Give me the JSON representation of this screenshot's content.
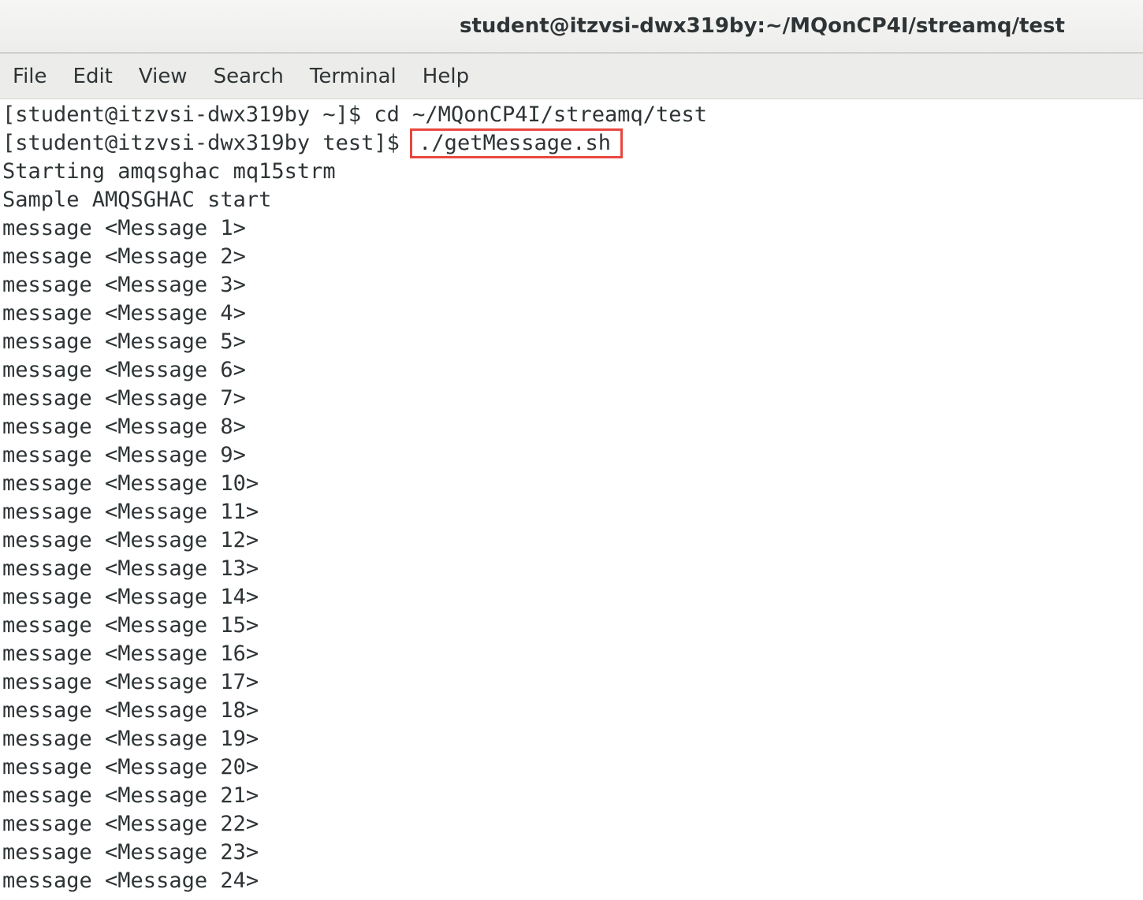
{
  "window": {
    "title": "student@itzvsi-dwx319by:~/MQonCP4I/streamq/test"
  },
  "menubar": {
    "items": [
      "File",
      "Edit",
      "View",
      "Search",
      "Terminal",
      "Help"
    ]
  },
  "terminal": {
    "line1": {
      "prompt": "[student@itzvsi-dwx319by ~]$ ",
      "command": "cd ~/MQonCP4I/streamq/test"
    },
    "line2": {
      "prompt": "[student@itzvsi-dwx319by test]$ ",
      "command": "./getMessage.sh"
    },
    "output": [
      "Starting amqsghac mq15strm",
      "Sample AMQSGHAC start",
      "message <Message 1>",
      "message <Message 2>",
      "message <Message 3>",
      "message <Message 4>",
      "message <Message 5>",
      "message <Message 6>",
      "message <Message 7>",
      "message <Message 8>",
      "message <Message 9>",
      "message <Message 10>",
      "message <Message 11>",
      "message <Message 12>",
      "message <Message 13>",
      "message <Message 14>",
      "message <Message 15>",
      "message <Message 16>",
      "message <Message 17>",
      "message <Message 18>",
      "message <Message 19>",
      "message <Message 20>",
      "message <Message 21>",
      "message <Message 22>",
      "message <Message 23>",
      "message <Message 24>"
    ],
    "highlight_color": "#e8473f"
  }
}
